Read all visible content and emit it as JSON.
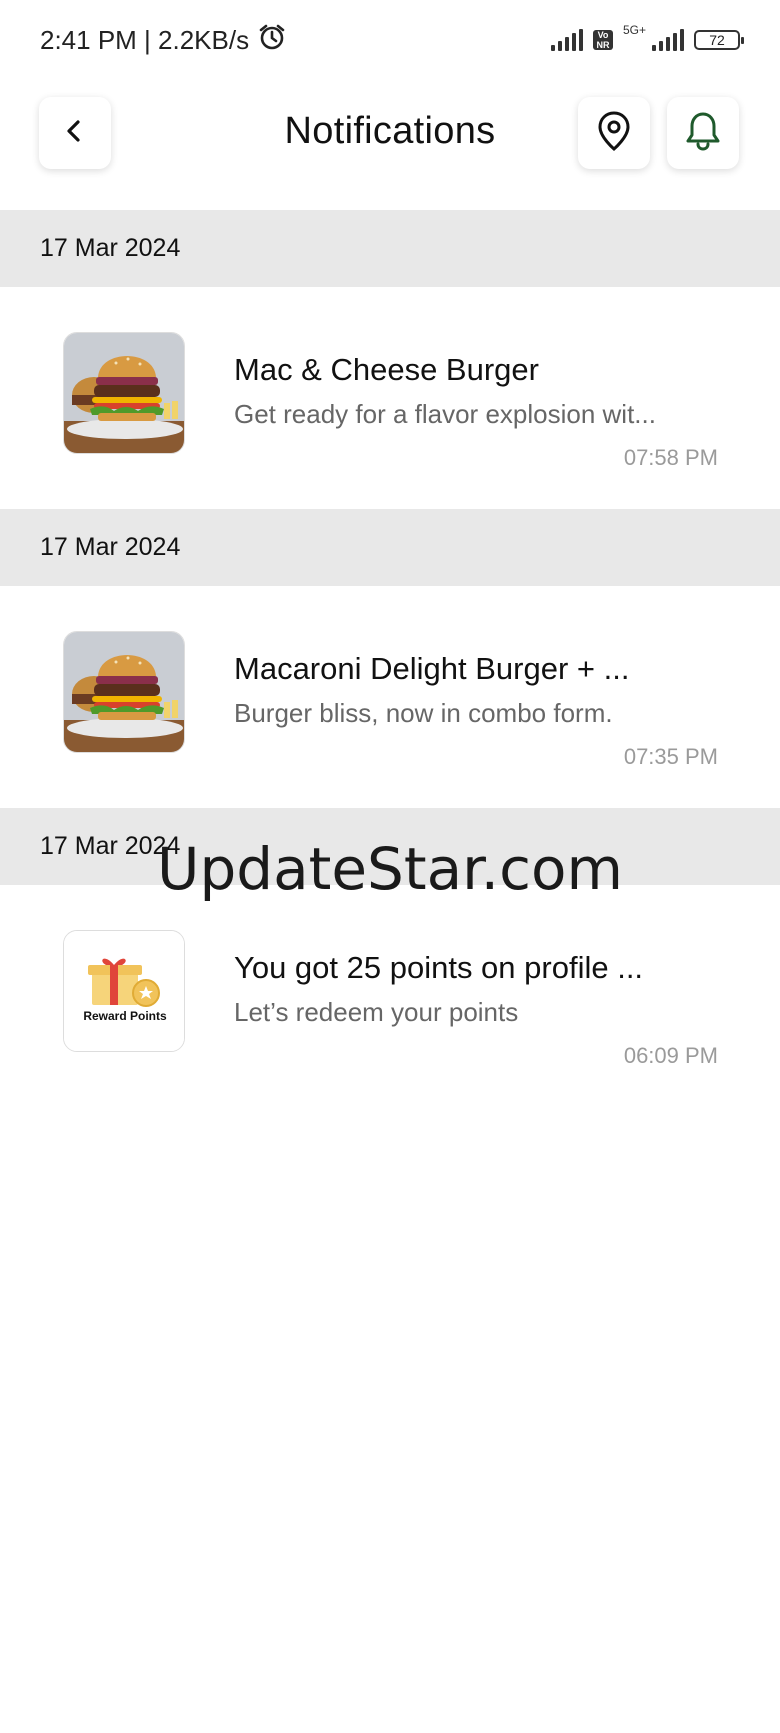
{
  "status_bar": {
    "time_speed": "2:41 PM | 2.2KB/s",
    "network_badge": "5G+",
    "volte": "Vo LTE",
    "battery": "72",
    "icons": [
      "alarm-icon",
      "signal-icon",
      "volte-icon",
      "battery-icon"
    ]
  },
  "header": {
    "title": "Notifications",
    "back_icon": "chevron-left-icon",
    "location_icon": "location-pin-icon",
    "bell_icon": "bell-icon",
    "bell_color": "#1f5a2c"
  },
  "notifications": [
    {
      "date": "17 Mar 2024",
      "title": "Mac & Cheese Burger",
      "description": "Get ready for a flavor explosion wit...",
      "time": "07:58 PM",
      "thumbnail": "burger-image"
    },
    {
      "date": "17 Mar 2024",
      "title": "Macaroni Delight Burger + ...",
      "description": "Burger bliss, now in combo form.",
      "time": "07:35 PM",
      "thumbnail": "burger-image"
    },
    {
      "date": "17 Mar 2024",
      "title": "You got 25 points on profile ...",
      "description": "Let’s redeem your points",
      "time": "06:09 PM",
      "thumbnail": "reward-points-image",
      "thumbnail_label": "Reward Points"
    }
  ],
  "watermark": "UpdateStar.com"
}
